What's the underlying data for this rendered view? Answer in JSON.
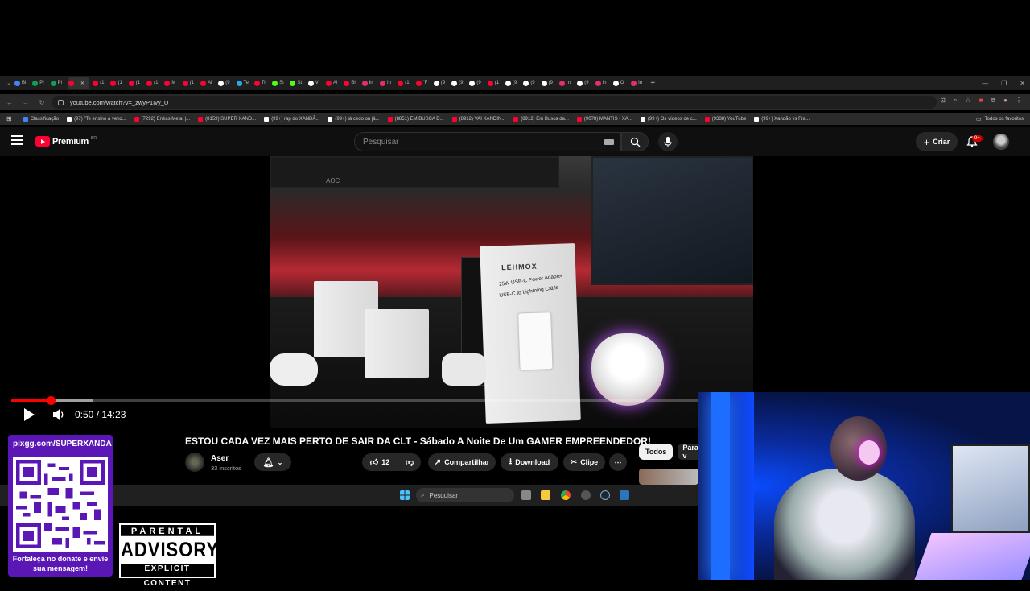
{
  "browser": {
    "tabs": [
      {
        "label": "Bi",
        "color": "#4285f4"
      },
      {
        "label": "Pi",
        "color": "#0f9d58"
      },
      {
        "label": "Pi",
        "color": "#0f9d58"
      },
      {
        "label": "",
        "color": "#ff0033",
        "active": true
      },
      {
        "label": "(1",
        "color": "#ff0033"
      },
      {
        "label": "(1",
        "color": "#ff0033"
      },
      {
        "label": "(1",
        "color": "#ff0033"
      },
      {
        "label": "(1",
        "color": "#ff0033"
      },
      {
        "label": "M",
        "color": "#ff0033"
      },
      {
        "label": "(1",
        "color": "#ff0033"
      },
      {
        "label": "Al",
        "color": "#ff0033"
      },
      {
        "label": "(9",
        "color": "#ffffff"
      },
      {
        "label": "Te",
        "color": "#29a9ea"
      },
      {
        "label": "Tr",
        "color": "#ff0033"
      },
      {
        "label": "St",
        "color": "#53fc18"
      },
      {
        "label": "St",
        "color": "#53fc18"
      },
      {
        "label": "Vi",
        "color": "#ffffff"
      },
      {
        "label": "Al",
        "color": "#ff0033"
      },
      {
        "label": "Bl",
        "color": "#ff0033"
      },
      {
        "label": "In",
        "color": "#e1306c"
      },
      {
        "label": "In",
        "color": "#e1306c"
      },
      {
        "label": "(1",
        "color": "#ff0033"
      },
      {
        "label": "\"F",
        "color": "#ff0033"
      },
      {
        "label": "(9",
        "color": "#ffffff"
      },
      {
        "label": "(9",
        "color": "#ffffff"
      },
      {
        "label": "(9",
        "color": "#ffffff"
      },
      {
        "label": "(1",
        "color": "#ff0033"
      },
      {
        "label": "(9",
        "color": "#ffffff"
      },
      {
        "label": "(9",
        "color": "#ffffff"
      },
      {
        "label": "(9",
        "color": "#ffffff"
      },
      {
        "label": "In",
        "color": "#e1306c"
      },
      {
        "label": "(9",
        "color": "#ffffff"
      },
      {
        "label": "In",
        "color": "#e1306c"
      },
      {
        "label": "O",
        "color": "#ffffff"
      },
      {
        "label": "In",
        "color": "#e1306c"
      }
    ],
    "url": "youtube.com/watch?v=_zwyP1Ivy_U",
    "bookmarks": [
      {
        "label": "Classificação",
        "color": "#4285f4"
      },
      {
        "label": "(97) \"Te ensino a venc...",
        "color": "#ffffff"
      },
      {
        "label": "(7292) Enéas Metal |...",
        "color": "#ff0033"
      },
      {
        "label": "(8159) SUPER XAND...",
        "color": "#ff0033"
      },
      {
        "label": "(99+) rap do XANDÃ...",
        "color": "#ffffff"
      },
      {
        "label": "(99+) tá cedo ou já...",
        "color": "#ffffff"
      },
      {
        "label": "(8851) EM BUSCA D...",
        "color": "#ff0033"
      },
      {
        "label": "(8912) VAI XANDIN...",
        "color": "#ff0033"
      },
      {
        "label": "(8912) Em Busca da...",
        "color": "#ff0033"
      },
      {
        "label": "(9078) MANTIS - XA...",
        "color": "#ff0033"
      },
      {
        "label": "(99+) Os vídeos de c...",
        "color": "#ffffff"
      },
      {
        "label": "(9338) YouTube",
        "color": "#ff0033"
      },
      {
        "label": "(99+) Xandão vs Fra...",
        "color": "#ffffff"
      }
    ],
    "all_bookmarks": "Todos os favoritos"
  },
  "youtube": {
    "logo": "Premium",
    "country": "BR",
    "search_placeholder": "Pesquisar",
    "create": "Criar",
    "notifications": "9+",
    "player": {
      "time": "0:50 / 14:23",
      "progress_fraction": 0.058,
      "loaded_fraction": 0.12
    },
    "video_title": "ESTOU CADA VEZ MAIS PERTO DE SAIR DA CLT - Sábado A Noite De Um GAMER EMPREENDEDOR!",
    "channel": "Aser",
    "subscribers": "33 inscritos",
    "likes": "12",
    "share": "Compartilhar",
    "download": "Download",
    "clip": "Clipe",
    "filters": [
      "Todos",
      "Para v"
    ]
  },
  "video_scene": {
    "monitor_brand": "AOC",
    "box_brand": "LEHMOX",
    "box_line1": "25W USB-C Power Adapter",
    "box_line2": "USB-C to Lightning Cable"
  },
  "taskbar": {
    "search": "Pesquisar"
  },
  "overlay": {
    "donate_url": "pixgg.com/SUPERXANDA",
    "donate_message": "Fortaleça no donate e envie sua mensagem!",
    "advisory_top": "PARENTAL",
    "advisory_mid": "ADVISORY",
    "advisory_bottom": "EXPLICIT CONTENT"
  },
  "colors": {
    "yt_red": "#ff0033",
    "donate_purple": "#5b16b6",
    "webcam_blue": "#0a4cff"
  }
}
